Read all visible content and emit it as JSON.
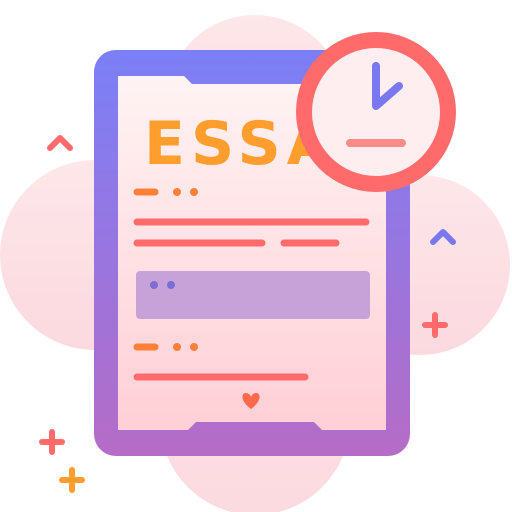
{
  "document": {
    "title": "ESSA"
  },
  "colors": {
    "blob": "#fde1e4",
    "frame_top": "#7b7ff7",
    "frame_bottom": "#b56cc6",
    "paper_top": "#fff3f3",
    "paper_bottom": "#ffcfd6",
    "title": "#ff9d2d",
    "line_red": "#ff6b6b",
    "line_orange": "#ff7f36",
    "panel": "#c7a2d9",
    "panel_dots": "#7b6cd6",
    "clock_ring": "#ff6b6b",
    "clock_face": "#ffeef0",
    "clock_hand": "#7a78f0",
    "clock_base": "#ff8a8a",
    "heart": "#ff6b4a"
  },
  "icons": {
    "main": "essay-document-icon",
    "badge": "clock-icon",
    "heart": "heart-icon",
    "decor": [
      "chevron-up-icon",
      "plus-icon"
    ]
  }
}
